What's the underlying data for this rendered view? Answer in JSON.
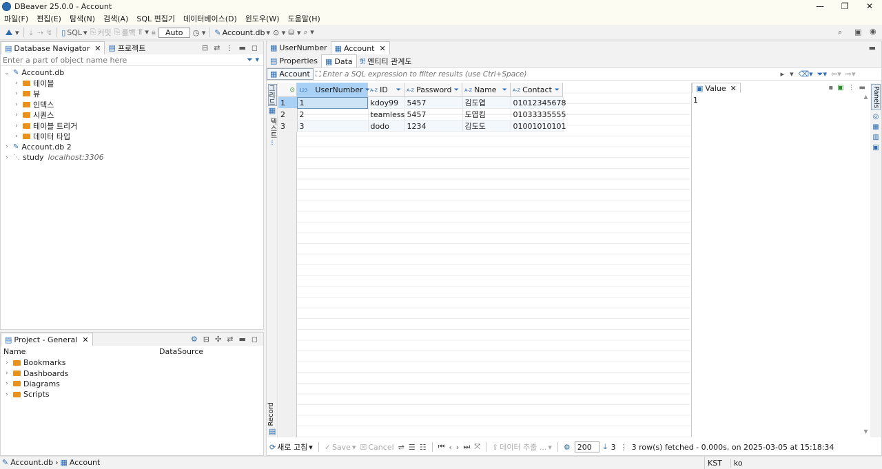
{
  "window": {
    "title": "DBeaver 25.0.0 - Account",
    "min": "—",
    "max": "❐",
    "close": "✕"
  },
  "menu": [
    "파일(F)",
    "편집(E)",
    "탐색(N)",
    "검색(A)",
    "SQL 편집기",
    "데이터베이스(D)",
    "윈도우(W)",
    "도움말(H)"
  ],
  "toolbar": {
    "sql": "SQL",
    "commit": "커밋",
    "rollback": "롤백",
    "auto": "Auto",
    "datasource": "Account.db"
  },
  "navigator": {
    "tab_label": "Database Navigator",
    "tab2_label": "프로젝트",
    "filter_placeholder": "Enter a part of object name here",
    "tree": [
      {
        "label": "Account.db",
        "level": 0,
        "expanded": true,
        "icon": "db-icon"
      },
      {
        "label": "테이블",
        "level": 1,
        "icon": "folder-icon"
      },
      {
        "label": "뷰",
        "level": 1,
        "icon": "folder-icon"
      },
      {
        "label": "인덱스",
        "level": 1,
        "icon": "folder-icon"
      },
      {
        "label": "시퀀스",
        "level": 1,
        "icon": "folder-icon"
      },
      {
        "label": "테이블 트리거",
        "level": 1,
        "icon": "folder-icon"
      },
      {
        "label": "데이터 타입",
        "level": 1,
        "icon": "folder-icon"
      },
      {
        "label": "Account.db 2",
        "level": 0,
        "icon": "db-icon"
      },
      {
        "label": "study",
        "sub": "localhost:3306",
        "level": 0,
        "icon": "mysql-icon"
      }
    ]
  },
  "project": {
    "tab_label": "Project - General",
    "col_name": "Name",
    "col_datasource": "DataSource",
    "items": [
      "Bookmarks",
      "Dashboards",
      "Diagrams",
      "Scripts"
    ]
  },
  "editor": {
    "tabs": [
      "UserNumber",
      "Account"
    ],
    "subtabs": [
      "Properties",
      "Data",
      "엔티티 관계도"
    ],
    "filter_table": "Account",
    "filter_placeholder": "Enter a SQL expression to filter results (use Ctrl+Space)",
    "side_labels": {
      "grid": "그리드",
      "text": "텍스트",
      "record": "Record"
    },
    "columns": [
      {
        "type": "123",
        "name": "UserNumber"
      },
      {
        "type": "A-Z",
        "name": "ID"
      },
      {
        "type": "A-Z",
        "name": "Password"
      },
      {
        "type": "A-Z",
        "name": "Name"
      },
      {
        "type": "A-Z",
        "name": "Contact"
      }
    ],
    "rows": [
      {
        "n": "1",
        "cells": [
          "1",
          "kdoy99",
          "5457",
          "김도엽",
          "01012345678"
        ]
      },
      {
        "n": "2",
        "cells": [
          "2",
          "teamless",
          "5457",
          "도엽킴",
          "01033335555"
        ]
      },
      {
        "n": "3",
        "cells": [
          "3",
          "dodo",
          "1234",
          "김도도",
          "01001010101"
        ]
      }
    ],
    "value_panel": {
      "label": "Value",
      "content": "1"
    },
    "panels_label": "Panels",
    "bottom": {
      "refresh": "새로 고침",
      "save": "Save",
      "cancel": "Cancel",
      "export": "데이터 추출 ...",
      "fetch_size": "200",
      "count": "3",
      "status": "3 row(s) fetched - 0.000s, on 2025-03-05 at 15:18:34"
    }
  },
  "statusbar": {
    "crumb1": "Account.db",
    "crumb2": "Account",
    "tz": "KST",
    "locale": "ko"
  },
  "colors": {
    "accent": "#2b6cb0",
    "folder": "#e8911c",
    "selection": "#cde4f7",
    "header_selected": "#a9d0f5"
  }
}
